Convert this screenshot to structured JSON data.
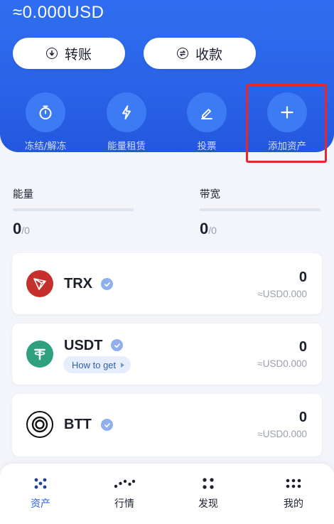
{
  "header": {
    "balance": "≈0.000USD",
    "transfer_label": "转账",
    "receive_label": "收款",
    "actions": [
      {
        "label": "冻结/解冻",
        "icon": "stopwatch-icon"
      },
      {
        "label": "能量租赁",
        "icon": "lightning-icon"
      },
      {
        "label": "投票",
        "icon": "pen-icon"
      },
      {
        "label": "添加资产",
        "icon": "plus-icon"
      }
    ]
  },
  "resources": {
    "energy": {
      "title": "能量",
      "used": "0",
      "total": "/0",
      "fraction": 0
    },
    "bandwidth": {
      "title": "带宽",
      "used": "0",
      "total": "/0",
      "fraction": 0
    }
  },
  "tokens": [
    {
      "symbol": "TRX",
      "amount": "0",
      "fiat": "≈USD0.000",
      "logo_color": "#c6302c"
    },
    {
      "symbol": "USDT",
      "amount": "0",
      "fiat": "≈USD0.000",
      "logo_color": "#2fa07e",
      "how_to_get": "How to get"
    },
    {
      "symbol": "BTT",
      "amount": "0",
      "fiat": "≈USD0.000",
      "logo_color": "#111111"
    }
  ],
  "nav": [
    {
      "label": "资产",
      "active": true
    },
    {
      "label": "行情",
      "active": false
    },
    {
      "label": "发现",
      "active": false
    },
    {
      "label": "我的",
      "active": false
    }
  ],
  "colors": {
    "accent": "#2a64e8",
    "highlight": "#e8272b"
  }
}
